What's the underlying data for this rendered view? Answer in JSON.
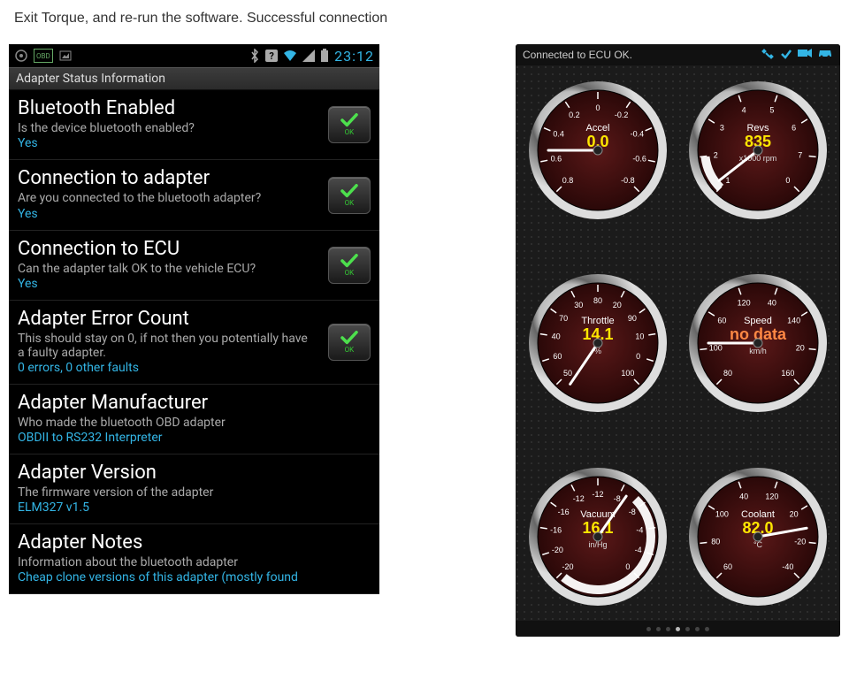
{
  "instruction": "Exit Torque, and re-run the software. Successful connection",
  "left": {
    "statusbar": {
      "time": "23:12"
    },
    "header": "Adapter Status Information",
    "items": [
      {
        "title": "Bluetooth Enabled",
        "desc": "Is the device bluetooth enabled?",
        "value": "Yes",
        "ok": true
      },
      {
        "title": "Connection to adapter",
        "desc": "Are you connected to the bluetooth adapter?",
        "value": "Yes",
        "ok": true
      },
      {
        "title": "Connection to ECU",
        "desc": "Can the adapter talk OK to the vehicle ECU?",
        "value": "Yes",
        "ok": true
      },
      {
        "title": "Adapter Error Count",
        "desc": "This should stay on 0, if not then you potentially have a faulty adapter.",
        "value": "0 errors, 0 other faults",
        "ok": true
      },
      {
        "title": "Adapter Manufacturer",
        "desc": "Who made the bluetooth OBD adapter",
        "value": "OBDII to RS232 Interpreter",
        "ok": false
      },
      {
        "title": "Adapter Version",
        "desc": "The firmware version of the adapter",
        "value": "ELM327 v1.5",
        "ok": false
      },
      {
        "title": "Adapter Notes",
        "desc": "Information about the bluetooth adapter",
        "value": "Cheap clone versions of this adapter (mostly found",
        "ok": false
      }
    ]
  },
  "right": {
    "status_text": "Connected to ECU OK.",
    "pager": {
      "count": 7,
      "active": 3
    },
    "gauges": [
      {
        "label": "Accel",
        "value": "0.0",
        "unit": "",
        "ticks": [
          "0.8",
          "0.6",
          "0.4",
          "0.2",
          "0",
          "-0.2",
          "-0.4",
          "-0.6",
          "-0.8"
        ],
        "angle": 180,
        "sweep": [
          0,
          0
        ],
        "value_color": "#ffe600"
      },
      {
        "label": "Revs",
        "value": "835",
        "unit": "x1000 rpm",
        "ticks": [
          "1",
          "2",
          "3",
          "4",
          "5",
          "6",
          "7",
          "0"
        ],
        "angle": 142,
        "sweep": [
          135,
          173
        ],
        "value_color": "#ffe600"
      },
      {
        "label": "Throttle",
        "value": "14.1",
        "unit": "%",
        "ticks": [
          "50",
          "60",
          "40",
          "70",
          "30",
          "80",
          "20",
          "90",
          "10",
          "0",
          "100"
        ],
        "angle": 124,
        "sweep": [
          0,
          0
        ],
        "value_color": "#ffe600"
      },
      {
        "label": "Speed",
        "value": "no data",
        "unit": "km/h",
        "ticks": [
          "80",
          "100",
          "60",
          "120",
          "40",
          "140",
          "20",
          "160"
        ],
        "angle": 180,
        "sweep": [
          0,
          0
        ],
        "value_color": "#ff8844"
      },
      {
        "label": "Vacuum",
        "value": "16.1",
        "unit": "in/Hg",
        "ticks": [
          "-20",
          "-20",
          "-16",
          "-16",
          "-12",
          "-12",
          "-8",
          "-8",
          "-4",
          "-4",
          "0"
        ],
        "angle": -55,
        "sweep": [
          130,
          -45
        ],
        "value_color": "#ffe600"
      },
      {
        "label": "Coolant",
        "value": "82.0",
        "unit": "°C",
        "ticks": [
          "60",
          "80",
          "100",
          "40",
          "120",
          "20",
          "-20",
          "-40"
        ],
        "angle": -10,
        "sweep": [
          0,
          0
        ],
        "value_color": "#ffe600"
      }
    ]
  }
}
